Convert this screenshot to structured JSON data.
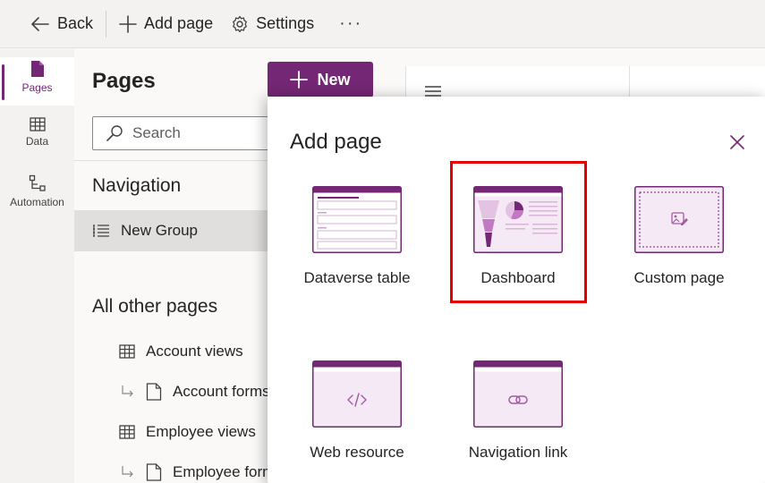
{
  "toolbar": {
    "back_label": "Back",
    "add_page_label": "Add page",
    "settings_label": "Settings",
    "more_label": "···"
  },
  "rail": {
    "items": [
      {
        "label": "Pages",
        "icon": "page-icon",
        "active": true
      },
      {
        "label": "Data",
        "icon": "table-icon"
      },
      {
        "label": "Automation",
        "icon": "flow-icon"
      }
    ]
  },
  "panel": {
    "title": "Pages",
    "new_label": "New",
    "search_placeholder": "Search",
    "navigation_heading": "Navigation",
    "group_label": "New Group",
    "other_heading": "All other pages",
    "pages": [
      {
        "label": "Account views",
        "icon": "table-icon",
        "child": false
      },
      {
        "label": "Account forms",
        "icon": "form-icon",
        "child": true
      },
      {
        "label": "Employee views",
        "icon": "table-icon",
        "child": false
      },
      {
        "label": "Employee forms",
        "icon": "form-icon",
        "child": true
      }
    ]
  },
  "dialog": {
    "title": "Add page",
    "tiles": [
      {
        "label": "Dataverse table",
        "icon": "dataverse-table-thumbnail"
      },
      {
        "label": "Dashboard",
        "icon": "dashboard-thumbnail",
        "highlighted": true
      },
      {
        "label": "Custom page",
        "icon": "custom-page-thumbnail"
      },
      {
        "label": "Web resource",
        "icon": "web-resource-thumbnail"
      },
      {
        "label": "Navigation link",
        "icon": "navigation-link-thumbnail"
      }
    ]
  },
  "colors": {
    "accent": "#742774",
    "accent_light": "#f5e9f5",
    "highlight": "#e50000"
  }
}
